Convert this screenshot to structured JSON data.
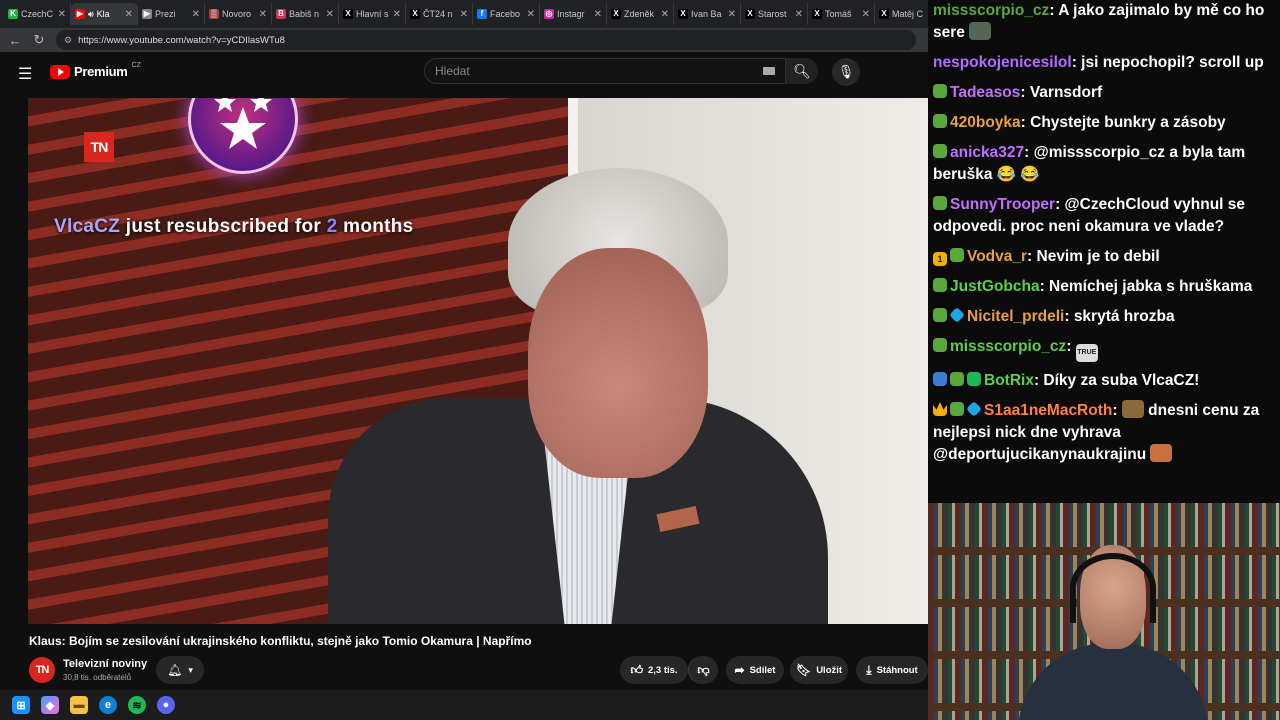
{
  "browser": {
    "tabs": [
      {
        "title": "CzechC",
        "icon": "kick-icon",
        "color": "#1fb54a",
        "glyph": "K"
      },
      {
        "title": "Kla",
        "icon": "youtube-icon",
        "color": "#ff0000",
        "glyph": "▶",
        "active": true
      },
      {
        "title": "Prezi",
        "icon": "tab-icon",
        "color": "#888888",
        "glyph": "▶"
      },
      {
        "title": "Novoro",
        "icon": "tab-icon",
        "color": "#a04040",
        "glyph": "▒"
      },
      {
        "title": "Babiš n",
        "icon": "tab-icon",
        "color": "#cc3355",
        "glyph": "B"
      },
      {
        "title": "Hlavní s",
        "icon": "x-icon",
        "color": "#000000",
        "glyph": "X"
      },
      {
        "title": "ČT24 n",
        "icon": "x-icon",
        "color": "#000000",
        "glyph": "X"
      },
      {
        "title": "Facebo",
        "icon": "facebook-icon",
        "color": "#1877f2",
        "glyph": "f"
      },
      {
        "title": "Instagr",
        "icon": "instagram-icon",
        "color": "#d6249f",
        "glyph": "◎"
      },
      {
        "title": "Zdeněk",
        "icon": "x-icon",
        "color": "#000000",
        "glyph": "X"
      },
      {
        "title": "Ivan Ba",
        "icon": "x-icon",
        "color": "#000000",
        "glyph": "X"
      },
      {
        "title": "Starost",
        "icon": "x-icon",
        "color": "#000000",
        "glyph": "X"
      },
      {
        "title": "Tomáš",
        "icon": "x-icon",
        "color": "#000000",
        "glyph": "X"
      },
      {
        "title": "Matěj C",
        "icon": "x-icon",
        "color": "#000000",
        "glyph": "X"
      }
    ],
    "url": "https://www.youtube.com/watch?v=yCDIlasWTu8"
  },
  "youtube": {
    "logo_text": "Premium",
    "logo_region": "CZ",
    "search_placeholder": "Hledat",
    "overlay": {
      "tn_badge": "TN",
      "sub_user": "VlcaCZ",
      "sub_mid": " just resubscribed for ",
      "sub_num": "2",
      "sub_end": " months"
    },
    "video_title": "Klaus: Bojím se zesilování ukrajinského konfliktu, stejně jako Tomio Okamura | Napřímo",
    "channel_name": "Televizní noviny",
    "channel_subs": "30,8 tis. odběratelů",
    "channel_avatar": "TN",
    "likes": "2,3 tis.",
    "share_label": "Sdílet",
    "save_label": "Uložit",
    "download_label": "Stáhnout"
  },
  "chat": [
    {
      "badges": [],
      "user": "missscorpio_cz",
      "user_color": "#5aa83a",
      "text": "A jako zajimalo by mě co ho sere",
      "emote": true
    },
    {
      "badges": [],
      "user": "nespokojenicesilol",
      "user_color": "#b46cff",
      "text": "jsi nepochopil? scroll up"
    },
    {
      "badges": [
        "leaf"
      ],
      "user": "Tadeasos",
      "user_color": "#c070ff",
      "text": "Varnsdorf"
    },
    {
      "badges": [
        "leaf"
      ],
      "user": "420boyka",
      "user_color": "#e8a040",
      "text": "Chystejte bunkry a zásoby"
    },
    {
      "badges": [
        "leaf"
      ],
      "user": "anicka327",
      "user_color": "#c070ff",
      "text": "@missscorpio_cz a byla tam beruška 😂 😂"
    },
    {
      "badges": [
        "leaf"
      ],
      "user": "SunnyTrooper",
      "user_color": "#c070ff",
      "text": "@CzechCloud vyhnul se odpovedi. proc neni okamura ve vlade?"
    },
    {
      "badges": [
        "gold",
        "leaf"
      ],
      "user": "Vodva_r",
      "user_color": "#e8a040",
      "text": "Nevim je to debil"
    },
    {
      "badges": [
        "leaf"
      ],
      "user": "JustGobcha",
      "user_color": "#5ad04a",
      "text": "Nemíchej jabka s hruškama"
    },
    {
      "badges": [
        "leaf",
        "cube"
      ],
      "user": "Nicitel_prdeli",
      "user_color": "#e8a040",
      "text": "skrytá hrozba"
    },
    {
      "badges": [
        "leaf"
      ],
      "user": "missscorpio_cz",
      "user_color": "#5ad04a",
      "text": "",
      "emote_label": "TRUE"
    },
    {
      "badges": [
        "blue",
        "leaf",
        "check"
      ],
      "user": "BotRix",
      "user_color": "#5ad04a",
      "text": "Díky za suba VlcaCZ!"
    },
    {
      "badges": [
        "crown",
        "leaf",
        "cube"
      ],
      "user": "S1aa1neMacRoth",
      "user_color": "#ff8040",
      "text": "dnesni cenu za nejlepsi nick dne vyhrava @deportujucikanynaukrajinu",
      "emote": true
    }
  ],
  "colors": {
    "accent": "#ff0000",
    "sub_highlight": "#a6a6ff"
  }
}
